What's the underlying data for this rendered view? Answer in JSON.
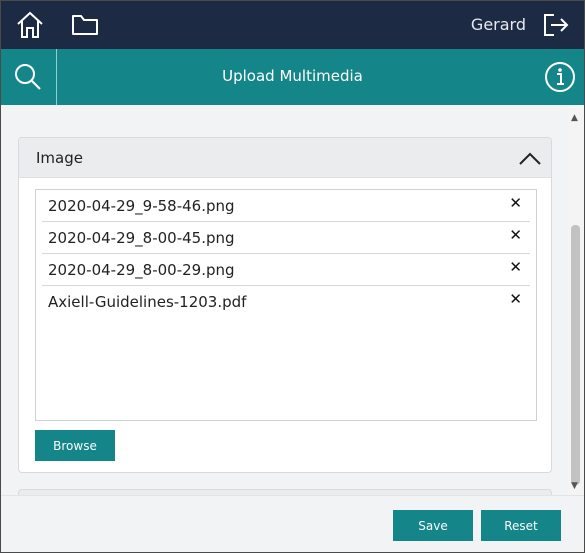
{
  "header": {
    "user_name": "Gerard",
    "icons": [
      "home-icon",
      "folder-icon",
      "logout-icon"
    ]
  },
  "titlebar": {
    "title": "Upload Multimedia",
    "icons": [
      "search-icon",
      "info-icon"
    ]
  },
  "panel": {
    "title": "Image",
    "files": [
      {
        "name": "2020-04-29_9-58-46.png",
        "remove": "✕"
      },
      {
        "name": "2020-04-29_8-00-45.png",
        "remove": "✕"
      },
      {
        "name": "2020-04-29_8-00-29.png",
        "remove": "✕"
      },
      {
        "name": "Axiell-Guidelines-1203.pdf",
        "remove": "✕"
      }
    ],
    "browse_label": "Browse"
  },
  "footer": {
    "save_label": "Save",
    "reset_label": "Reset"
  },
  "colors": {
    "navbar": "#1c2a44",
    "accent": "#14868a",
    "background": "#f2f3f5"
  }
}
